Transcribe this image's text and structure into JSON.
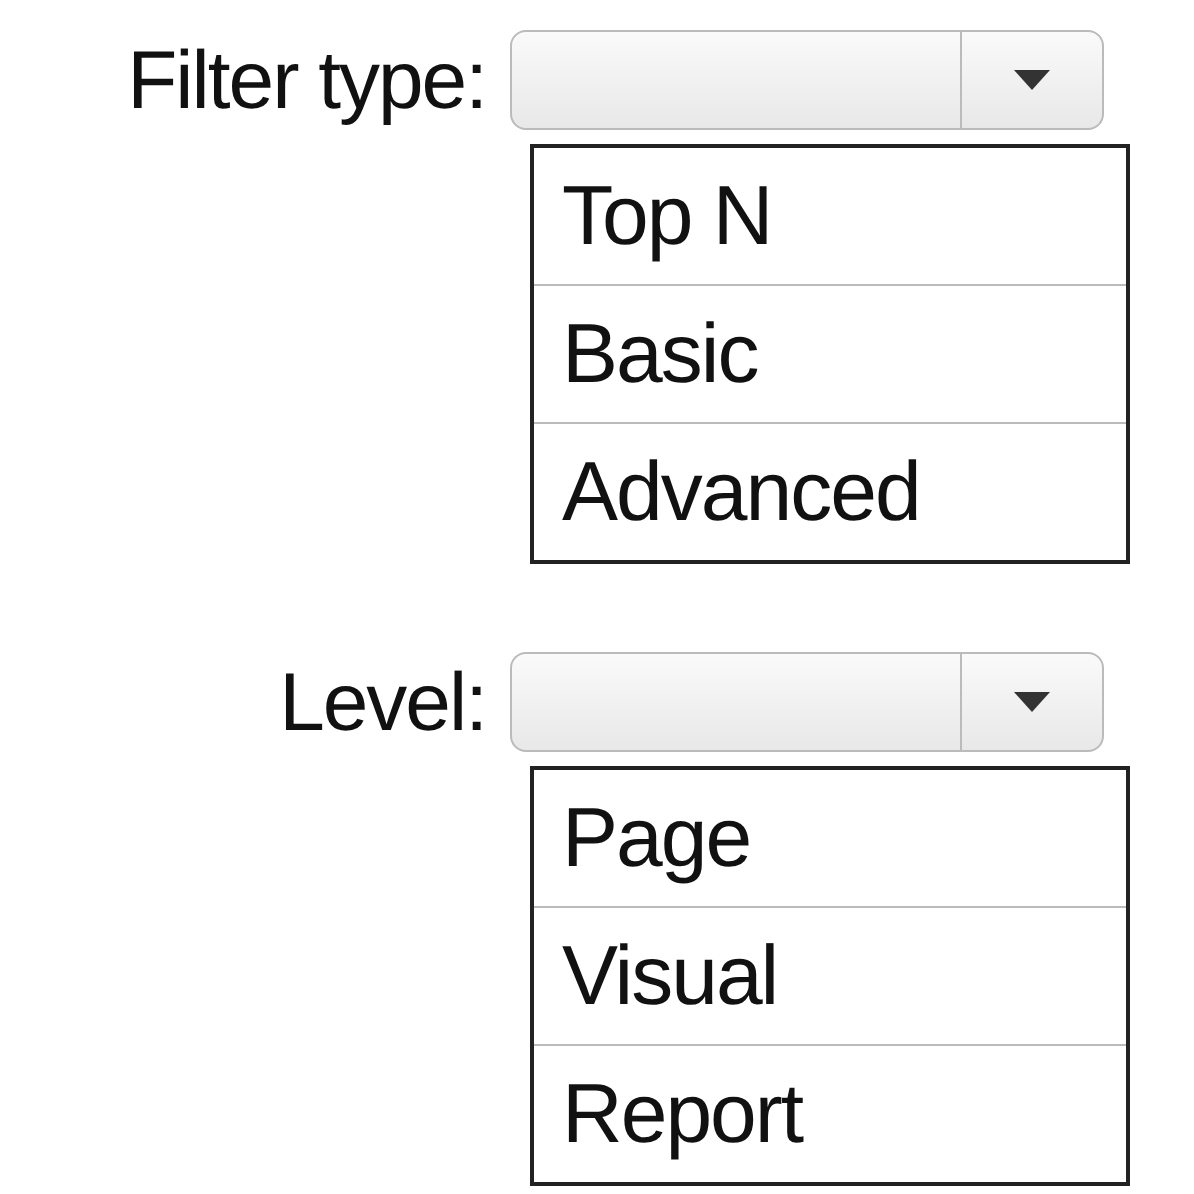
{
  "fields": [
    {
      "label": "Filter type:",
      "options": [
        "Top N",
        "Basic",
        "Advanced"
      ]
    },
    {
      "label": "Level:",
      "options": [
        "Page",
        "Visual",
        "Report"
      ]
    }
  ]
}
